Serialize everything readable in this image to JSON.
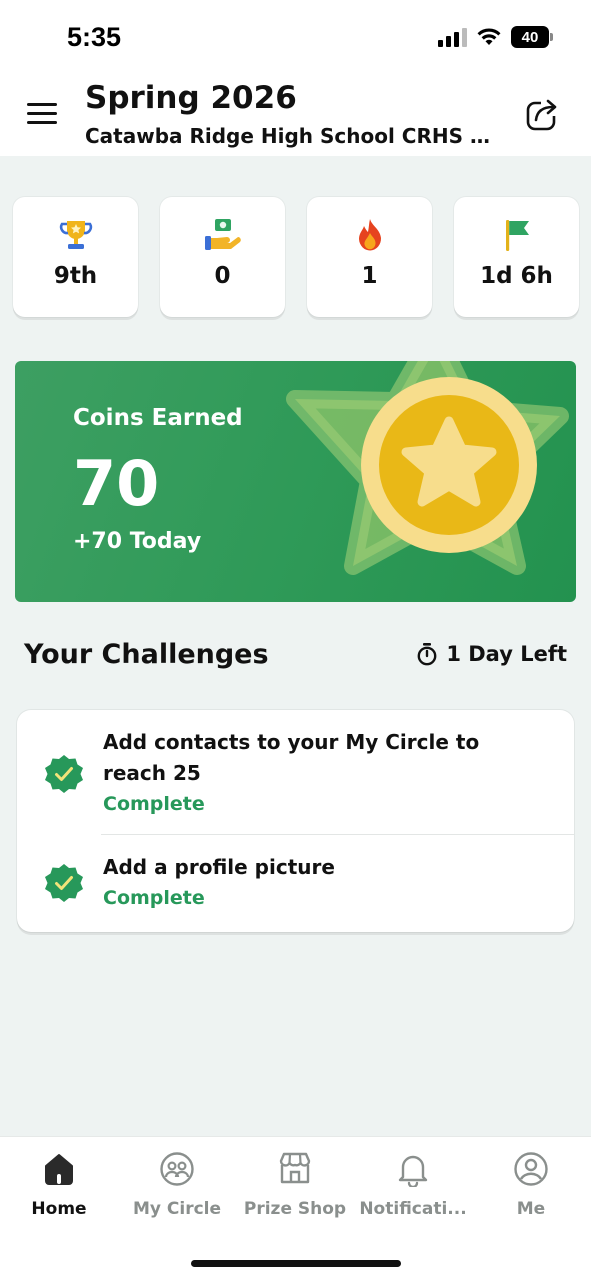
{
  "status_bar": {
    "time": "5:35",
    "battery": "40",
    "icons": [
      "signal-icon",
      "wifi-icon",
      "battery-icon"
    ]
  },
  "header": {
    "title": "Spring 2026",
    "subtitle": "Catawba Ridge High School CRHS B...",
    "menu_icon": "hamburger-icon",
    "share_icon": "share-icon"
  },
  "stats": [
    {
      "icon": "trophy-icon",
      "value": "9th"
    },
    {
      "icon": "hand-coin-icon",
      "value": "0"
    },
    {
      "icon": "flame-icon",
      "value": "1"
    },
    {
      "icon": "flag-icon",
      "value": "1d 6h"
    }
  ],
  "coins": {
    "label": "Coins Earned",
    "value": "70",
    "today": "+70 Today",
    "icon": "star-coin-icon"
  },
  "challenges": {
    "title": "Your Challenges",
    "time_left": "1 Day Left",
    "time_icon": "stopwatch-icon",
    "items": [
      {
        "text": "Add contacts to your My Circle to reach 25",
        "status": "Complete",
        "icon": "check-badge-icon"
      },
      {
        "text": "Add a profile picture",
        "status": "Complete",
        "icon": "check-badge-icon"
      }
    ]
  },
  "nav": {
    "items": [
      {
        "label": "Home",
        "icon": "home-icon",
        "active": true
      },
      {
        "label": "My Circle",
        "icon": "circle-faces-icon",
        "active": false
      },
      {
        "label": "Prize Shop",
        "icon": "shop-icon",
        "active": false
      },
      {
        "label": "Notificati...",
        "icon": "bell-icon",
        "active": false
      },
      {
        "label": "Me",
        "icon": "user-icon",
        "active": false
      }
    ]
  },
  "colors": {
    "accent_green": "#27985a",
    "banner_green": "#2f9a58",
    "coin_gold": "#e9b817",
    "coin_ring": "#f6d98a",
    "background": "#eef3f2"
  }
}
